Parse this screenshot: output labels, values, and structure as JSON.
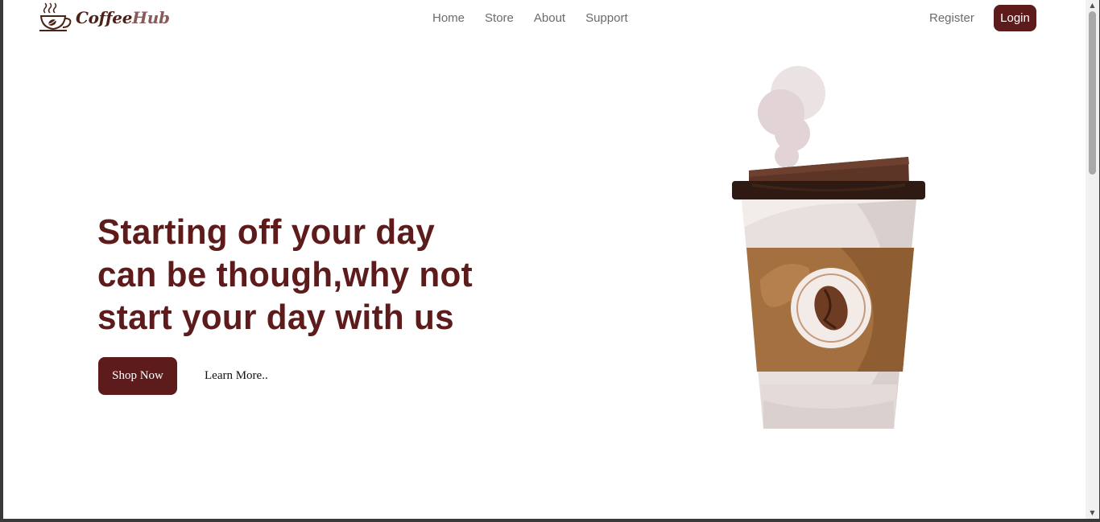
{
  "brand": {
    "name_part1": "Coffee",
    "name_part2": "Hub"
  },
  "nav": {
    "links": [
      {
        "label": "Home"
      },
      {
        "label": "Store"
      },
      {
        "label": "About"
      },
      {
        "label": "Support"
      }
    ],
    "register_label": "Register",
    "login_label": "Login"
  },
  "hero": {
    "title_lines": [
      "Starting off your day",
      "can be though,why not",
      "start your day with us"
    ],
    "shop_now_label": "Shop Now",
    "learn_more_label": "Learn More.."
  },
  "colors": {
    "primary": "#5e1b1b",
    "nav_text": "#6b6b6b",
    "cup_sleeve": "#a5703f",
    "cup_lid": "#3a1f14"
  },
  "icons": {
    "logo": "coffee-cup-icon",
    "illustration": "coffee-cup-illustration",
    "scroll_up": "triangle-up-icon",
    "scroll_down": "triangle-down-icon"
  }
}
